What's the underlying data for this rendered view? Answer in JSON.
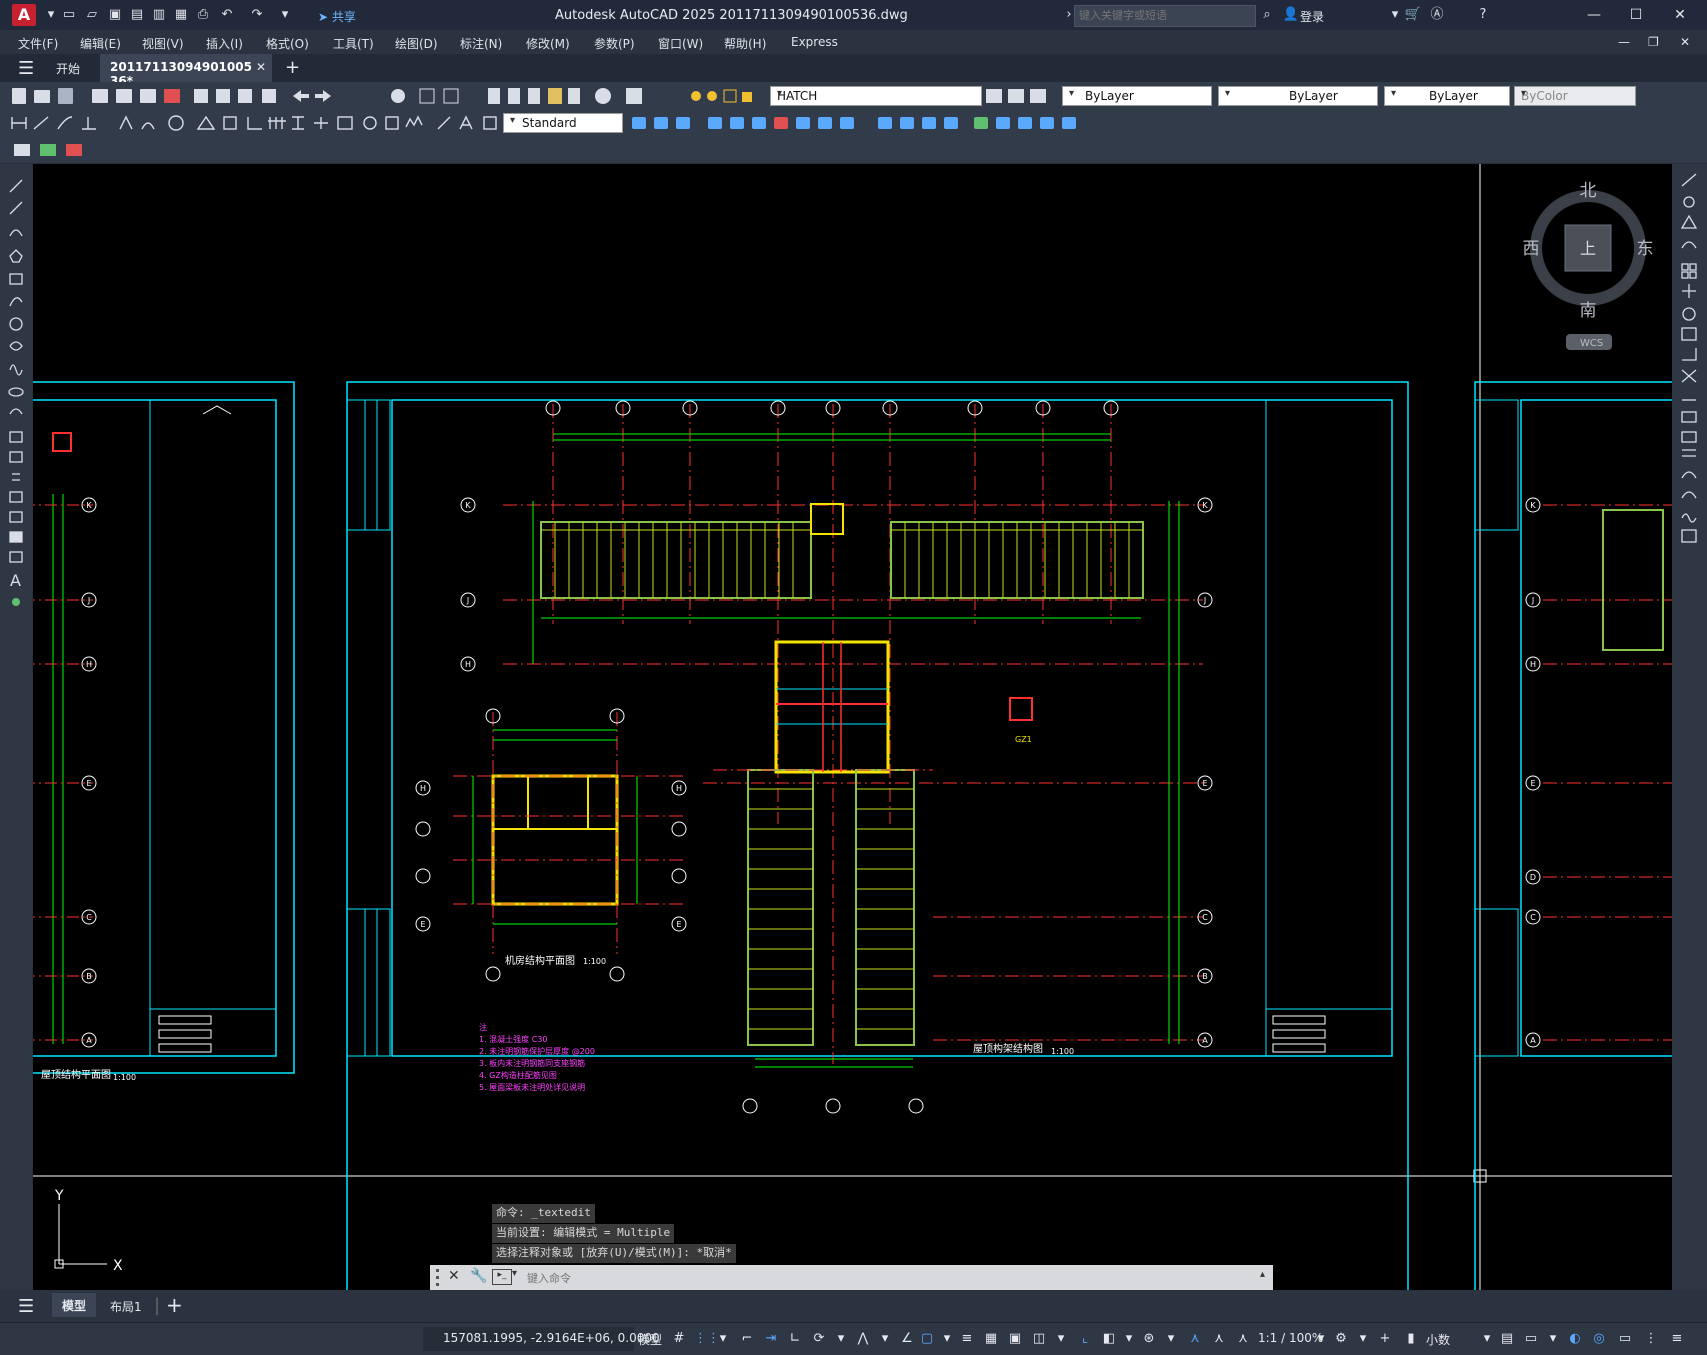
{
  "app": {
    "logo": "A",
    "title": "Autodesk AutoCAD 2025    20117113094901005​36.dwg",
    "share_label": "共享",
    "search_placeholder": "键入关键字或短语",
    "login_label": "登录"
  },
  "menu": [
    "文件(F)",
    "编辑(E)",
    "视图(V)",
    "插入(I)",
    "格式(O)",
    "工具(T)",
    "绘图(D)",
    "标注(N)",
    "修改(M)",
    "参数(P)",
    "窗口(W)",
    "帮助(H)",
    "Express"
  ],
  "tabs": {
    "start": "开始",
    "document": "20117113094901005​36*"
  },
  "toolbar": {
    "layer": "HATCH",
    "color": "ByLayer",
    "linetype": "ByLayer",
    "lineweight": "ByLayer",
    "plotstyle": "ByColor",
    "dimstyle": "Standard"
  },
  "viewcube": {
    "north": "北",
    "south": "南",
    "east": "东",
    "west": "西",
    "top": "上",
    "wcs": "WCS"
  },
  "ucs": {
    "x": "X",
    "y": "Y"
  },
  "drawing": {
    "title_roof": "屋顶结构平面图",
    "title_machine": "机房结构平面图",
    "title_frame": "屋顶构架结构图",
    "scale": "1:100",
    "grid_k": "K",
    "grid_j": "J",
    "grid_h": "H",
    "grid_e": "E",
    "grid_c": "C",
    "grid_b": "B",
    "grid_a": "A",
    "grid_d": "D",
    "col_label": "GZ1",
    "notes_title": "注",
    "notes": [
      "1. 混凝土强度 C30",
      "2. 未注明钢筋保护层厚度 @200",
      "3. 板内未注明钢筋同支座钢筋",
      "4. GZ构造柱配筋见图",
      "5. 屋面梁板未注明处详见说明"
    ]
  },
  "command": {
    "history": [
      "命令: _textedit",
      "当前设置: 编辑模式 = Multiple",
      "选择注释对象或 [放弃(U)/模式(M)]: *取消*"
    ],
    "input_placeholder": "键入命令"
  },
  "layout_tabs": {
    "model": "模型",
    "layout1": "布局1"
  },
  "status": {
    "coords": "157081.1995, -2.9164E+06, 0.0000",
    "space": "模型",
    "scale": "1:1 / 100%",
    "units": "小数"
  }
}
